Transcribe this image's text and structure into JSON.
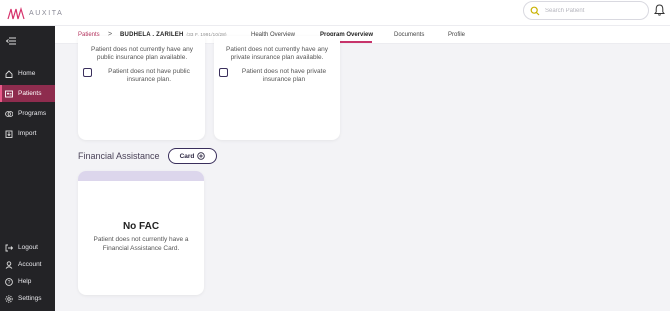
{
  "app": {
    "logo_text": "AUXITA"
  },
  "search": {
    "placeholder": "Search Patient"
  },
  "sidebar": {
    "items": [
      {
        "label": "Home",
        "icon": "home-icon"
      },
      {
        "label": "Patients",
        "icon": "patients-icon",
        "active": true
      },
      {
        "label": "Programs",
        "icon": "programs-icon"
      },
      {
        "label": "Import",
        "icon": "import-icon"
      },
      {
        "label": "Logout",
        "icon": "logout-icon"
      },
      {
        "label": "Account",
        "icon": "account-icon"
      },
      {
        "label": "Help",
        "icon": "help-icon"
      },
      {
        "label": "Settings",
        "icon": "settings-icon"
      }
    ]
  },
  "breadcrumb": {
    "root": "Patients",
    "separator": ">",
    "patient_name": "BUDHELA , ZARILEH",
    "patient_meta": "(33 F, 1991/10/28)"
  },
  "tabs": [
    {
      "label": "Health Overview"
    },
    {
      "label": "Program Overview",
      "active": true
    },
    {
      "label": "Documents"
    },
    {
      "label": "Profile"
    }
  ],
  "public_card": {
    "desc": "Patient does not currently have any public insurance plan available.",
    "checkbox_label": "Patient does not have public insurance plan."
  },
  "private_card": {
    "desc": "Patient does not currently have any private insurance plan available.",
    "checkbox_label": "Patient does not have private insurance plan"
  },
  "financial": {
    "title": "Financial Assistance",
    "add_label": "Card",
    "empty_title": "No FAC",
    "empty_desc": "Patient does not currently have a Financial Assistance Card."
  },
  "colors": {
    "accent": "#c7336b",
    "sidebar_bg": "#232326",
    "sidebar_active": "#8e2c4e",
    "button_border": "#3a2f5c"
  }
}
